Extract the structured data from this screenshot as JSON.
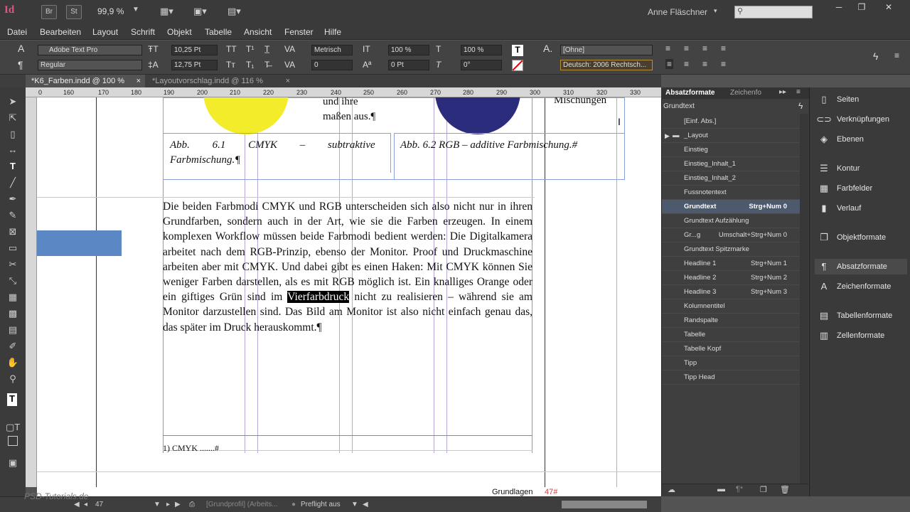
{
  "app": {
    "logo": "Id",
    "bridge_btn": "Br",
    "stock_btn": "St",
    "zoom": "99,9 %",
    "user": "Anne Fläschner"
  },
  "menu": [
    "Datei",
    "Bearbeiten",
    "Layout",
    "Schrift",
    "Objekt",
    "Tabelle",
    "Ansicht",
    "Fenster",
    "Hilfe"
  ],
  "control": {
    "font": "Adobe Text Pro",
    "style": "Regular",
    "size": "10,25 Pt",
    "leading": "12,75 Pt",
    "kerning": "Metrisch",
    "tracking": "0",
    "vscale": "100 %",
    "hscale": "100 %",
    "baseline": "0 Pt",
    "skew": "0°",
    "charstyle": "[Ohne]",
    "language": "Deutsch: 2006 Rechtsch..."
  },
  "tabs": [
    {
      "label": "*K6_Farben.indd @ 100 %",
      "close": "×"
    },
    {
      "label": "*Layoutvorschlag.indd @ 116 %",
      "close": "×"
    }
  ],
  "ruler": {
    "h": [
      "0",
      "160",
      "170",
      "180",
      "190",
      "200",
      "210",
      "220",
      "230",
      "240",
      "250",
      "260",
      "270",
      "280",
      "290",
      "300",
      "310",
      "320",
      "330"
    ]
  },
  "document": {
    "cell_text_a": "und ihre",
    "cell_text_b": "maßen aus.¶",
    "cell_text_c": "Mischungen",
    "caption1_line1": "Abb. 6.1 CMYK – subtraktive",
    "caption1_line2": "Farbmischung.¶",
    "caption2": "Abb. 6.2 RGB – additive Farbmischung.#",
    "body_before": "Die beiden Farbmodi CMYK und RGB unterscheiden sich also nicht nur in ihren Grundfarben, sondern auch in der Art, wie sie die Farben erzeugen. In einem komplexen Workflow müssen beide Farbmodi bedient werden: Die Digitalkamera arbeitet nach dem RGB-Prinzip, ebenso der Monitor. Proof und Druckmaschine arbeiten aber mit CMYK. Und dabei gibt es einen Haken: Mit CMYK können Sie weniger Farben darstellen, als es mit RGB möglich ist. Ein knalliges Orange oder ein giftiges Grün sind im ",
    "body_selected": "Vierfarbdruck",
    "body_after": " nicht zu realisieren – während sie am Monitor darzustellen sind. Das Bild am Monitor ist also nicht einfach genau das, das später im Druck herauskommt.¶",
    "footnote": "1) CMYK .......#",
    "footer_label": "Grundlagen",
    "page_number": "47#",
    "colors": {
      "yellow": "#f2ec2a",
      "blue": "#2b2d7c",
      "swatch": "#5b87c5"
    }
  },
  "panel": {
    "tab_active": "Absatzformate",
    "tab_other": "Zeichenfo",
    "current": "Grundtext",
    "items": [
      {
        "name": "[Einf. Abs.]",
        "key": ""
      },
      {
        "name": "_Layout",
        "key": "",
        "folder": true
      },
      {
        "name": "Einstieg",
        "key": ""
      },
      {
        "name": "Einstieg_Inhalt_1",
        "key": ""
      },
      {
        "name": "Einstieg_Inhalt_2",
        "key": ""
      },
      {
        "name": "Fussnotentext",
        "key": ""
      },
      {
        "name": "Grundtext",
        "key": "Strg+Num 0",
        "selected": true
      },
      {
        "name": "Grundtext Aufzählung",
        "key": ""
      },
      {
        "name": "Gr...g",
        "key": "Umschalt+Strg+Num 0"
      },
      {
        "name": "Grundtext Spitzmarke",
        "key": ""
      },
      {
        "name": "Headline 1",
        "key": "Strg+Num 1"
      },
      {
        "name": "Headline 2",
        "key": "Strg+Num 2"
      },
      {
        "name": "Headline 3",
        "key": "Strg+Num 3"
      },
      {
        "name": "Kolumnentitel",
        "key": ""
      },
      {
        "name": "Randspalte",
        "key": ""
      },
      {
        "name": "Tabelle",
        "key": ""
      },
      {
        "name": "Tabelle Kopf",
        "key": ""
      },
      {
        "name": "Tipp",
        "key": ""
      },
      {
        "name": "Tipp Head",
        "key": ""
      }
    ]
  },
  "dock": [
    {
      "label": "Seiten",
      "icon": "pages-icon"
    },
    {
      "label": "Verknüpfungen",
      "icon": "links-icon"
    },
    {
      "label": "Ebenen",
      "icon": "layers-icon"
    },
    {
      "label": "Kontur",
      "icon": "stroke-icon"
    },
    {
      "label": "Farbfelder",
      "icon": "swatches-icon"
    },
    {
      "label": "Verlauf",
      "icon": "gradient-icon"
    },
    {
      "label": "Objektformate",
      "icon": "object-styles-icon"
    },
    {
      "label": "Absatzformate",
      "icon": "paragraph-styles-icon",
      "selected": true
    },
    {
      "label": "Zeichenformate",
      "icon": "character-styles-icon"
    },
    {
      "label": "Tabellenformate",
      "icon": "table-styles-icon"
    },
    {
      "label": "Zellenformate",
      "icon": "cell-styles-icon"
    }
  ],
  "status": {
    "page": "47",
    "profile": "[Grundprofil] (Arbeits...",
    "preflight": "Preflight aus",
    "watermark": "PSD-Tutorials.de"
  }
}
